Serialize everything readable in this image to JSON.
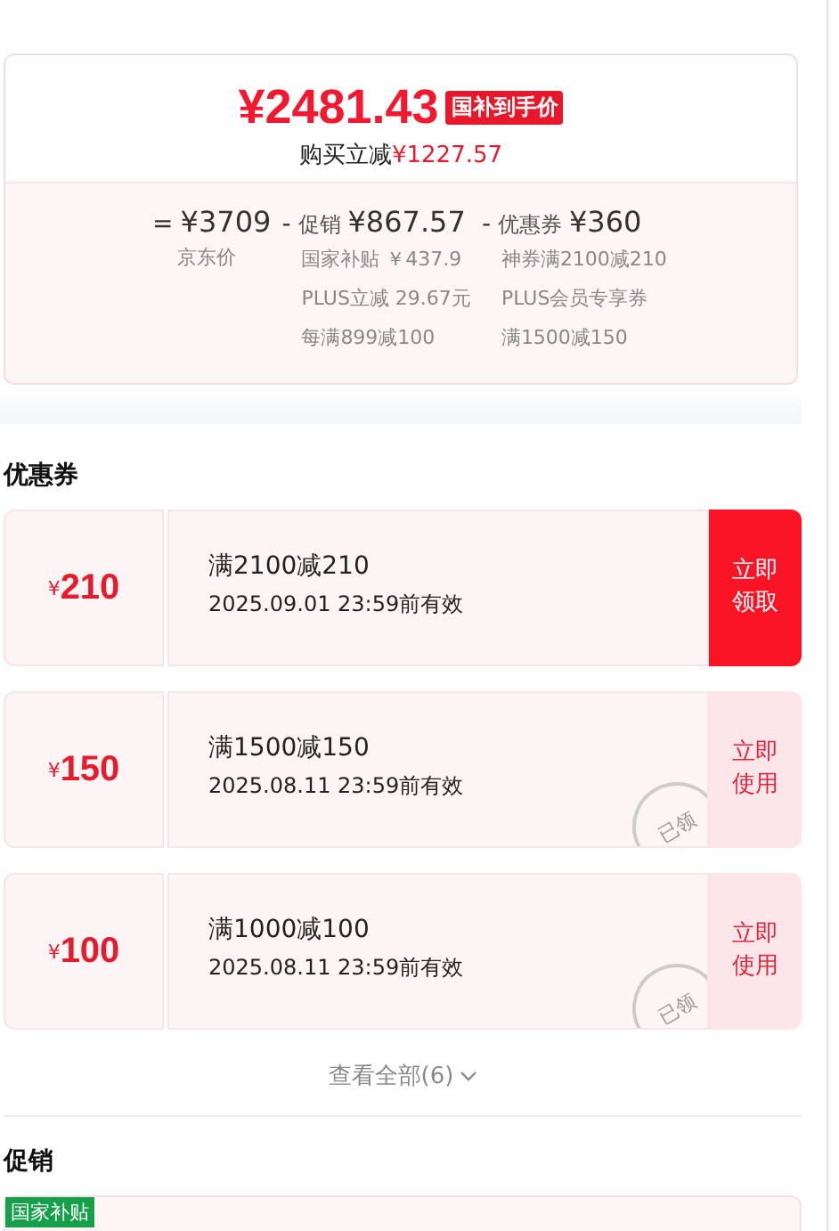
{
  "price_card": {
    "price": "¥2481.43",
    "price_tag": "国补到手价",
    "saving_label": "购买立减",
    "saving_amount": "¥1227.57",
    "breakdown": [
      {
        "operator": "=",
        "amount": "¥3709",
        "lines": [
          "京东价"
        ]
      },
      {
        "operator": "-",
        "label": "促销",
        "amount": "¥867.57",
        "lines": [
          "国家补贴 ￥437.9",
          "PLUS立减 29.67元",
          "每满899减100"
        ]
      },
      {
        "operator": "-",
        "label": "优惠券",
        "amount": "¥360",
        "lines": [
          "神券满2100减210",
          "PLUS会员专享券",
          "满1500减150"
        ]
      }
    ]
  },
  "coupons_section": {
    "title": "优惠券",
    "coupons": [
      {
        "currency": "¥",
        "value": "210",
        "condition": "满2100减210",
        "validity": "2025.09.01 23:59前有效",
        "claimed": false,
        "action": "立即领取"
      },
      {
        "currency": "¥",
        "value": "150",
        "condition": "满1500减150",
        "validity": "2025.08.11 23:59前有效",
        "claimed": true,
        "stamp": "已领",
        "action": "立即使用"
      },
      {
        "currency": "¥",
        "value": "100",
        "condition": "满1000减100",
        "validity": "2025.08.11 23:59前有效",
        "claimed": true,
        "stamp": "已领",
        "action": "立即使用"
      }
    ],
    "view_all": "查看全部(6)"
  },
  "promotions_section": {
    "title": "促销",
    "badge": "国家补贴"
  }
}
